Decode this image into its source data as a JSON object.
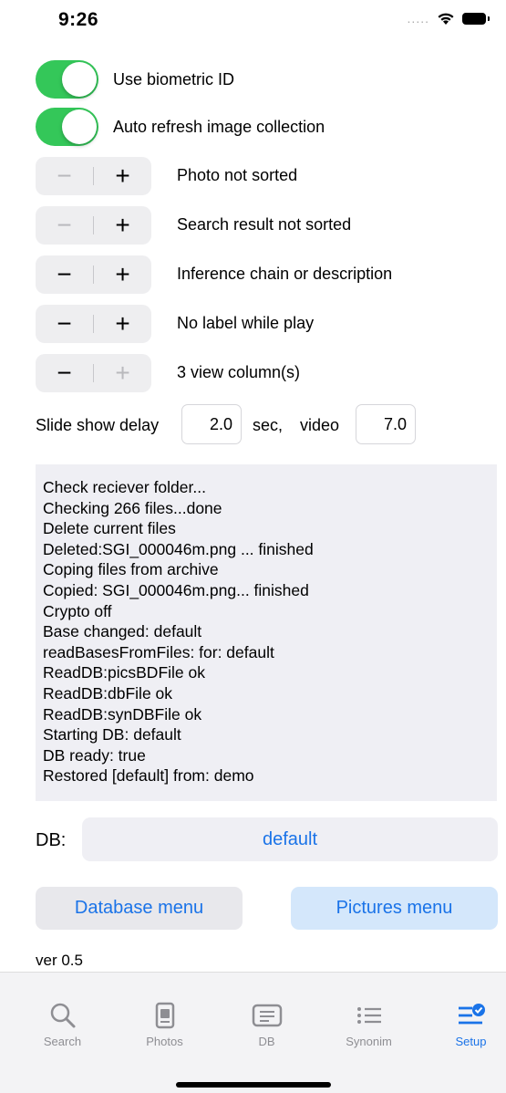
{
  "status": {
    "time": "9:26",
    "signal": "....."
  },
  "toggles": [
    {
      "label": "Use biometric ID",
      "on": true
    },
    {
      "label": "Auto refresh image collection",
      "on": true
    }
  ],
  "steppers": [
    {
      "label": "Photo not sorted",
      "minus_enabled": false,
      "plus_enabled": true
    },
    {
      "label": "Search result not sorted",
      "minus_enabled": false,
      "plus_enabled": true
    },
    {
      "label": "Inference chain or description",
      "minus_enabled": true,
      "plus_enabled": true
    },
    {
      "label": "No label while play",
      "minus_enabled": true,
      "plus_enabled": true
    },
    {
      "label": "3 view column(s)",
      "minus_enabled": true,
      "plus_enabled": false
    }
  ],
  "stepper_symbols": {
    "minus": "−",
    "plus": "+"
  },
  "slideshow": {
    "label": "Slide show delay",
    "delay_value": "2.0",
    "sec_label": "sec,",
    "video_label": "video",
    "video_value": "7.0"
  },
  "log": [
    "Check reciever folder...",
    "Checking 266 files...done",
    "Delete current files",
    "Deleted:SGI_000046m.png ... finished",
    "Coping files from archive",
    "Copied: SGI_000046m.png... finished",
    "Crypto off",
    "Base changed: default",
    "readBasesFromFiles: for: default",
    "ReadDB:picsBDFile ok",
    "ReadDB:dbFile ok",
    "ReadDB:synDBFile ok",
    "Starting DB: default",
    "DB ready: true",
    "Restored [default] from: demo"
  ],
  "db": {
    "label": "DB:",
    "value": "default"
  },
  "buttons": {
    "database_menu": "Database menu",
    "pictures_menu": "Pictures menu"
  },
  "version": "ver 0.5",
  "tabs": [
    {
      "label": "Search",
      "icon": "search-icon",
      "active": false
    },
    {
      "label": "Photos",
      "icon": "photos-icon",
      "active": false
    },
    {
      "label": "DB",
      "icon": "db-icon",
      "active": false
    },
    {
      "label": "Synonim",
      "icon": "list-icon",
      "active": false
    },
    {
      "label": "Setup",
      "icon": "setup-icon",
      "active": true
    }
  ],
  "colors": {
    "accent": "#1a73e8",
    "switch_on": "#34c759",
    "inactive": "#8e8e93"
  }
}
